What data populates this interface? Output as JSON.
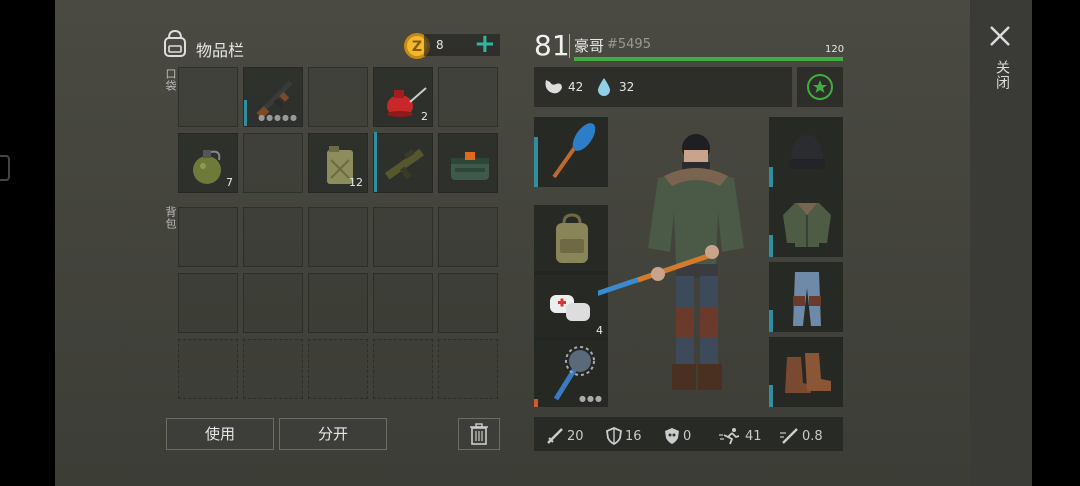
{
  "inventory": {
    "title": "物品栏",
    "coins": "8",
    "add_label": "+",
    "pocket_label": "口袋",
    "backpack_label": "背包",
    "pocket_items": [
      {
        "name": "empty"
      },
      {
        "name": "assault-rifle",
        "dots": "●●●●●"
      },
      {
        "name": "empty"
      },
      {
        "name": "oil-can",
        "count": "2"
      },
      {
        "name": "empty"
      },
      {
        "name": "grenade",
        "count": "7"
      },
      {
        "name": "empty"
      },
      {
        "name": "jerrycan",
        "count": "12"
      },
      {
        "name": "grenade-launcher"
      },
      {
        "name": "ammo-box"
      }
    ],
    "use_button": "使用",
    "split_button": "分开"
  },
  "player": {
    "level": "81",
    "name": "豪哥",
    "id": "#5495",
    "health_max": "120",
    "health_fraction": 1.0,
    "hunger": "42",
    "thirst": "32"
  },
  "equipment": {
    "left": [
      {
        "name": "oar-weapon"
      },
      {
        "name": "backpack"
      },
      {
        "name": "bandage",
        "count": "4"
      },
      {
        "name": "spiked-mace",
        "dots": "●●●"
      }
    ],
    "right": [
      {
        "name": "beanie-hat"
      },
      {
        "name": "green-jacket"
      },
      {
        "name": "jeans"
      },
      {
        "name": "brown-boots"
      }
    ]
  },
  "stats": {
    "attack": "20",
    "defense": "16",
    "armor": "0",
    "speed": "41",
    "attack_speed": "0.8"
  },
  "close_label": "关闭",
  "colors": {
    "health": "#3fae3f",
    "accent_add": "#2fb6a0",
    "durability": "#2f8fa0",
    "coin": "#e0a020"
  }
}
